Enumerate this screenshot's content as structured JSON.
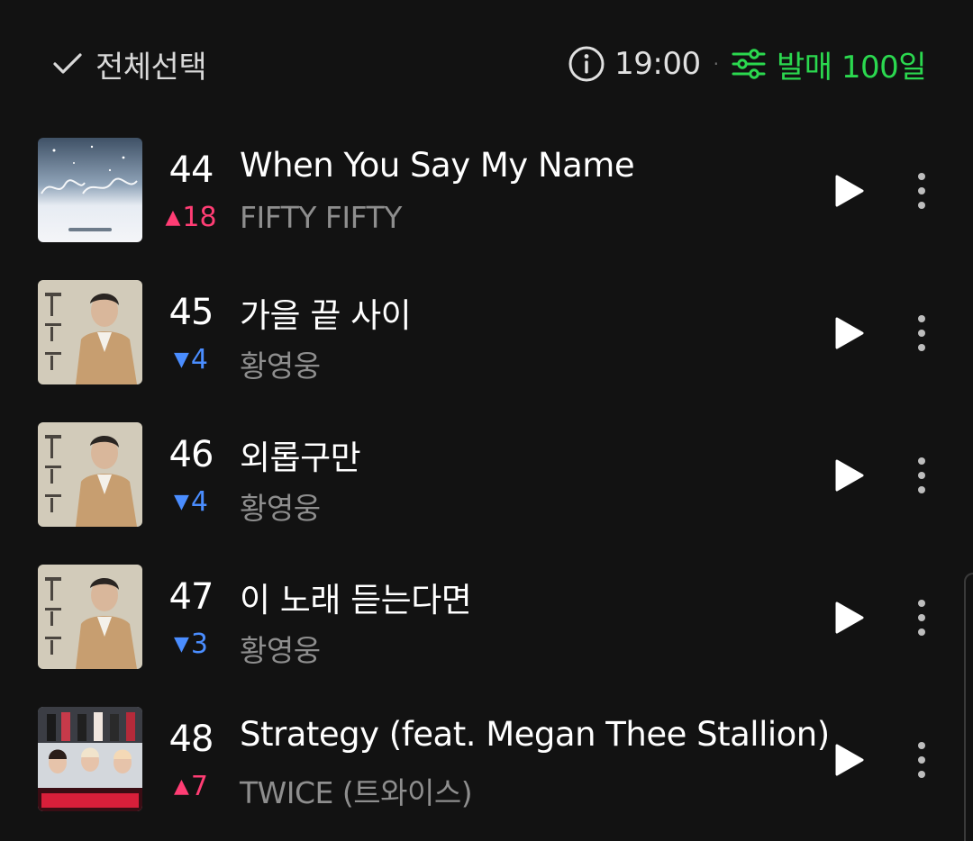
{
  "header": {
    "select_all_label": "전체선택",
    "time": "19:00",
    "separator": "·",
    "filter_label": "발매 100일"
  },
  "colors": {
    "background": "#121212",
    "accent_green": "#2bd84f",
    "rank_up": "#ff3d74",
    "rank_down": "#4a8dff"
  },
  "songs": [
    {
      "rank": "44",
      "change_dir": "up",
      "change_arrow": "▲",
      "change_value": "18",
      "title": "When You Say My Name",
      "artist": "FIFTY FIFTY"
    },
    {
      "rank": "45",
      "change_dir": "down",
      "change_arrow": "▼",
      "change_value": "4",
      "title": "가을 끝 사이",
      "artist": "황영웅"
    },
    {
      "rank": "46",
      "change_dir": "down",
      "change_arrow": "▼",
      "change_value": "4",
      "title": "외롭구만",
      "artist": "황영웅"
    },
    {
      "rank": "47",
      "change_dir": "down",
      "change_arrow": "▼",
      "change_value": "3",
      "title": "이 노래 듣는다면",
      "artist": "황영웅"
    },
    {
      "rank": "48",
      "change_dir": "up",
      "change_arrow": "▲",
      "change_value": "7",
      "title": "Strategy (feat. Megan Thee Stallion)",
      "artist": "TWICE (트와이스)"
    }
  ]
}
